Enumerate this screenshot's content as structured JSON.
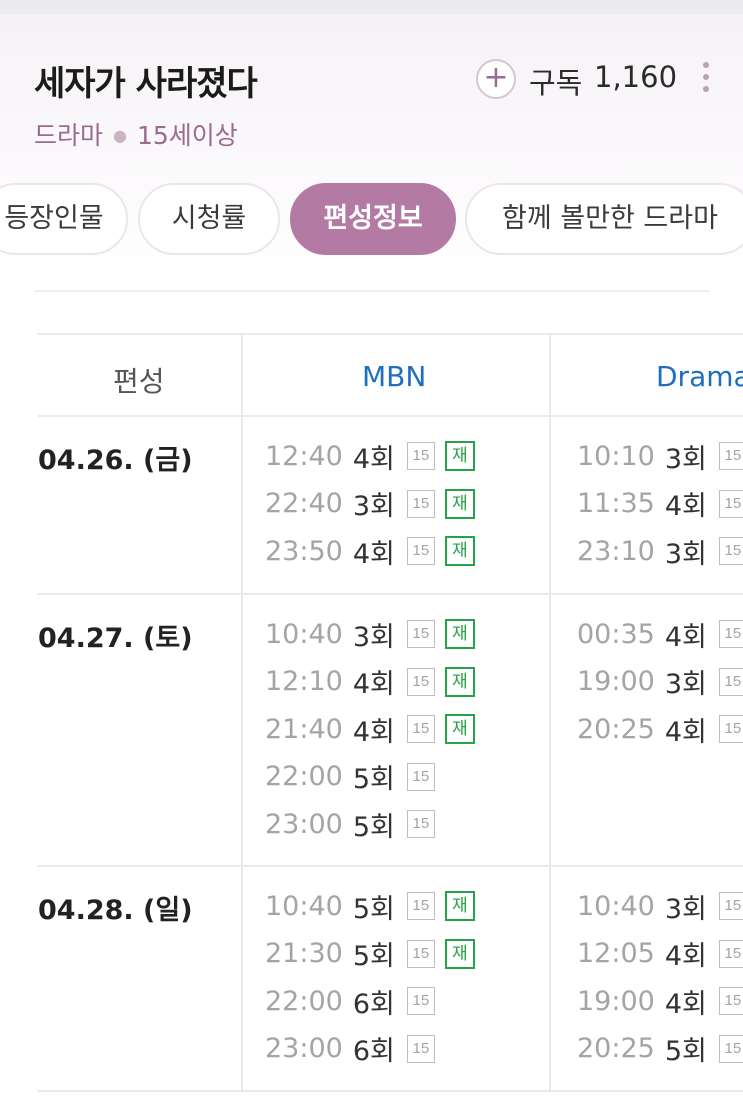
{
  "header": {
    "title": "세자가 사라졌다",
    "genre": "드라마",
    "rating": "15세이상",
    "subscribe_icon": "plus-icon",
    "subscribe_label": "구독",
    "subscribe_count": "1,160",
    "more_icon": "kebab-icon"
  },
  "tabs": [
    {
      "label": "등장인물",
      "active": false
    },
    {
      "label": "시청률",
      "active": false
    },
    {
      "label": "편성정보",
      "active": true
    },
    {
      "label": "함께 볼만한 드라마",
      "active": false
    }
  ],
  "colors": {
    "accent": "#b37aa3",
    "channel": "#1f6fc0",
    "rerun": "#25a24a"
  },
  "schedule": {
    "header_label": "편성",
    "channels": [
      "MBN",
      "Drama"
    ],
    "rows": [
      {
        "date": "04.26. (금)",
        "mbn": [
          {
            "time": "12:40",
            "ep": "4회",
            "age": "15",
            "re": "재"
          },
          {
            "time": "22:40",
            "ep": "3회",
            "age": "15",
            "re": "재"
          },
          {
            "time": "23:50",
            "ep": "4회",
            "age": "15",
            "re": "재"
          }
        ],
        "drama": [
          {
            "time": "10:10",
            "ep": "3회",
            "age": "15"
          },
          {
            "time": "11:35",
            "ep": "4회",
            "age": "15"
          },
          {
            "time": "23:10",
            "ep": "3회",
            "age": "15"
          }
        ]
      },
      {
        "date": "04.27. (토)",
        "mbn": [
          {
            "time": "10:40",
            "ep": "3회",
            "age": "15",
            "re": "재"
          },
          {
            "time": "12:10",
            "ep": "4회",
            "age": "15",
            "re": "재"
          },
          {
            "time": "21:40",
            "ep": "4회",
            "age": "15",
            "re": "재"
          },
          {
            "time": "22:00",
            "ep": "5회",
            "age": "15"
          },
          {
            "time": "23:00",
            "ep": "5회",
            "age": "15"
          }
        ],
        "drama": [
          {
            "time": "00:35",
            "ep": "4회",
            "age": "15"
          },
          {
            "time": "19:00",
            "ep": "3회",
            "age": "15"
          },
          {
            "time": "20:25",
            "ep": "4회",
            "age": "15"
          }
        ]
      },
      {
        "date": "04.28. (일)",
        "mbn": [
          {
            "time": "10:40",
            "ep": "5회",
            "age": "15",
            "re": "재"
          },
          {
            "time": "21:30",
            "ep": "5회",
            "age": "15",
            "re": "재"
          },
          {
            "time": "22:00",
            "ep": "6회",
            "age": "15"
          },
          {
            "time": "23:00",
            "ep": "6회",
            "age": "15"
          }
        ],
        "drama": [
          {
            "time": "10:40",
            "ep": "3회",
            "age": "15"
          },
          {
            "time": "12:05",
            "ep": "4회",
            "age": "15"
          },
          {
            "time": "19:00",
            "ep": "4회",
            "age": "15"
          },
          {
            "time": "20:25",
            "ep": "5회",
            "age": "15"
          }
        ]
      }
    ]
  }
}
